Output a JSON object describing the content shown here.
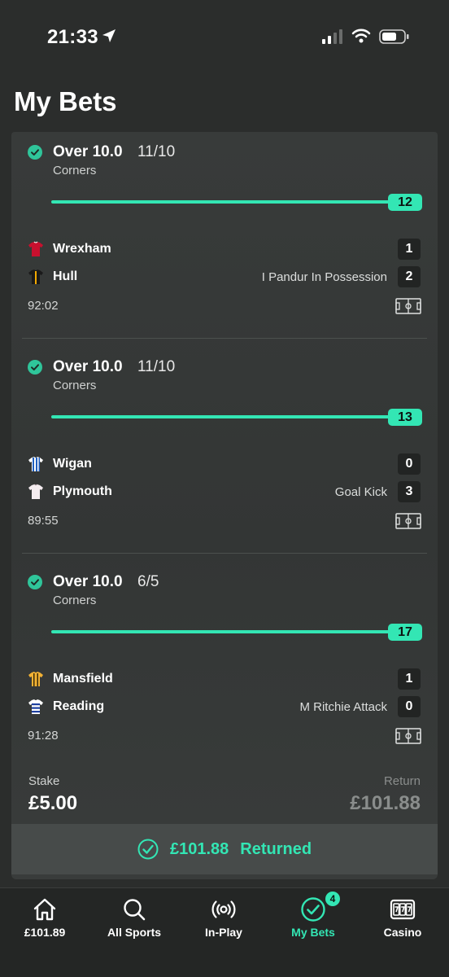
{
  "status_bar": {
    "time": "21:33"
  },
  "page_title": "My Bets",
  "legs": [
    {
      "selection": "Over 10.0",
      "odds": "11/10",
      "market": "Corners",
      "count": "12",
      "progress_fraction": 1.0,
      "home_team": "Wrexham",
      "away_team": "Hull",
      "home_score": "1",
      "away_score": "2",
      "event": "I Pandur In Possession",
      "event_row": "away",
      "clock": "92:02",
      "home_shirt": "red",
      "away_shirt": "black-amber"
    },
    {
      "selection": "Over 10.0",
      "odds": "11/10",
      "market": "Corners",
      "count": "13",
      "progress_fraction": 1.0,
      "home_team": "Wigan",
      "away_team": "Plymouth",
      "home_score": "0",
      "away_score": "3",
      "event": "Goal Kick",
      "event_row": "away",
      "clock": "89:55",
      "home_shirt": "blue-white-stripes",
      "away_shirt": "white"
    },
    {
      "selection": "Over 10.0",
      "odds": "6/5",
      "market": "Corners",
      "count": "17",
      "progress_fraction": 1.0,
      "home_team": "Mansfield",
      "away_team": "Reading",
      "home_score": "1",
      "away_score": "0",
      "event": "M Ritchie Attack",
      "event_row": "away",
      "clock": "91:28",
      "home_shirt": "amber-stripes",
      "away_shirt": "blue-white-hoops"
    }
  ],
  "stake": {
    "label": "Stake",
    "value": "£5.00"
  },
  "return": {
    "label": "Return",
    "value": "£101.88"
  },
  "returned_banner": {
    "amount": "£101.88",
    "text": "Returned"
  },
  "tab_bar": {
    "tabs": [
      {
        "label": "£101.89",
        "icon": "home-icon"
      },
      {
        "label": "All Sports",
        "icon": "search-icon"
      },
      {
        "label": "In-Play",
        "icon": "broadcast-icon"
      },
      {
        "label": "My Bets",
        "icon": "check-circle-icon",
        "active": true,
        "badge": "4"
      },
      {
        "label": "Casino",
        "icon": "slot-machine-icon"
      }
    ]
  },
  "colors": {
    "accent": "#33e6b4",
    "background": "#2b2d2c",
    "card": "#363938",
    "tab_bar": "#242625"
  }
}
